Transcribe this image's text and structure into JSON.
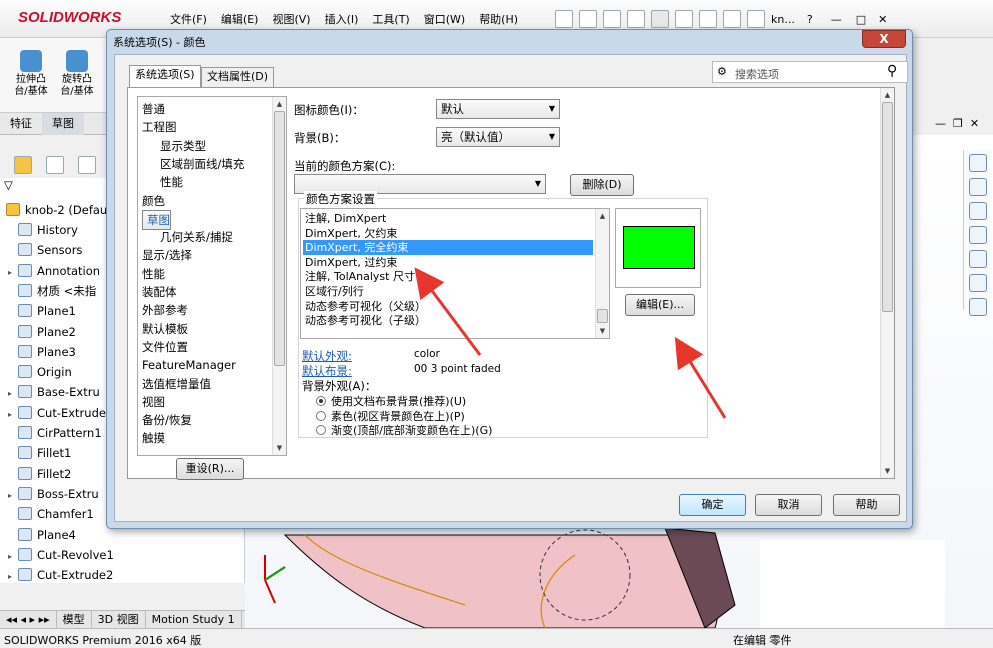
{
  "app": {
    "logo_text": "SOLIDWORKS",
    "menu": [
      "文件(F)",
      "编辑(E)",
      "视图(V)",
      "插入(I)",
      "工具(T)",
      "窗口(W)",
      "帮助(H)"
    ],
    "user": "kn..."
  },
  "command_manager": {
    "buttons": [
      "拉伸凸\n台/基体",
      "旋转凸\n台/基体"
    ],
    "tabs": [
      "特征",
      "草图"
    ]
  },
  "feature_tree": {
    "root": "knob-2  (Defau",
    "items": [
      {
        "label": "History",
        "expand": false
      },
      {
        "label": "Sensors",
        "expand": false
      },
      {
        "label": "Annotation",
        "expand": true
      },
      {
        "label": "材质 <未指",
        "expand": false
      },
      {
        "label": "Plane1",
        "expand": false
      },
      {
        "label": "Plane2",
        "expand": false
      },
      {
        "label": "Plane3",
        "expand": false
      },
      {
        "label": "Origin",
        "expand": false
      },
      {
        "label": "Base-Extru",
        "expand": true
      },
      {
        "label": "Cut-Extrude",
        "expand": true
      },
      {
        "label": "CirPattern1",
        "expand": false
      },
      {
        "label": "Fillet1",
        "expand": false
      },
      {
        "label": "Fillet2",
        "expand": false
      },
      {
        "label": "Boss-Extru",
        "expand": true
      },
      {
        "label": "Chamfer1",
        "expand": false
      },
      {
        "label": "Plane4",
        "expand": false
      },
      {
        "label": "Cut-Revolve1",
        "expand": true
      },
      {
        "label": "Cut-Extrude2",
        "expand": true
      }
    ]
  },
  "bottom_tabs": [
    "模型",
    "3D 视图",
    "Motion Study 1"
  ],
  "status": {
    "left": "SOLIDWORKS Premium 2016 x64 版",
    "right": "在编辑 零件"
  },
  "dialog": {
    "title": "系统选项(S) - 颜色",
    "close": "X",
    "tabs": [
      "系统选项(S)",
      "文档属性(D)"
    ],
    "search_placeholder": "搜索选项",
    "categories": [
      {
        "label": "普通",
        "sub": false,
        "sel": false
      },
      {
        "label": "工程图",
        "sub": false,
        "sel": false
      },
      {
        "label": "显示类型",
        "sub": true,
        "sel": false
      },
      {
        "label": "区域剖面线/填充",
        "sub": true,
        "sel": false
      },
      {
        "label": "性能",
        "sub": true,
        "sel": false
      },
      {
        "label": "颜色",
        "sub": false,
        "sel": false
      },
      {
        "label": "草图",
        "sub": false,
        "sel": true
      },
      {
        "label": "几何关系/捕捉",
        "sub": true,
        "sel": false
      },
      {
        "label": "显示/选择",
        "sub": false,
        "sel": false
      },
      {
        "label": "性能",
        "sub": false,
        "sel": false
      },
      {
        "label": "装配体",
        "sub": false,
        "sel": false
      },
      {
        "label": "外部参考",
        "sub": false,
        "sel": false
      },
      {
        "label": "默认模板",
        "sub": false,
        "sel": false
      },
      {
        "label": "文件位置",
        "sub": false,
        "sel": false
      },
      {
        "label": "FeatureManager",
        "sub": false,
        "sel": false
      },
      {
        "label": "选值框增量值",
        "sub": false,
        "sel": false
      },
      {
        "label": "视图",
        "sub": false,
        "sel": false
      },
      {
        "label": "备份/恢复",
        "sub": false,
        "sel": false
      },
      {
        "label": "触摸",
        "sub": false,
        "sel": false
      }
    ],
    "icon_color_label": "图标颜色(I)：",
    "icon_color_value": "默认",
    "background_label": "背景(B)：",
    "background_value": "亮（默认值）",
    "current_scheme_label": "当前的颜色方案(C):",
    "current_scheme_value": "",
    "delete_button": "删除(D)",
    "scheme_group_label": "颜色方案设置",
    "scheme_items": [
      "注解, DimXpert",
      "DimXpert, 欠约束",
      "DimXpert, 完全约束",
      "DimXpert, 过约束",
      "注解, TolAnalyst 尺寸",
      "区域行/列行",
      "动态参考可视化（父级）",
      "动态参考可视化（子级）"
    ],
    "scheme_selected_index": 2,
    "swatch_color": "#00ff00",
    "edit_button": "编辑(E)...",
    "default_appearance_label": "默认外观:",
    "default_appearance_value": "color",
    "default_layout_label": "默认布景:",
    "default_layout_value": "00 3 point faded",
    "bg_appearance_label": "背景外观(A)：",
    "bg_options": [
      {
        "label": "使用文档布景背景(推荐)(U)",
        "checked": true
      },
      {
        "label": "素色(视区背景颜色在上)(P)",
        "checked": false
      },
      {
        "label": "渐变(顶部/底部渐变颜色在上)(G)",
        "checked": false
      }
    ],
    "reset_button": "重设(R)...",
    "ok_button": "确定",
    "cancel_button": "取消",
    "help_button": "帮助"
  },
  "colors": {
    "accent": "#3399ff",
    "arrow": "#e8362c",
    "swatch": "#00ff00"
  }
}
